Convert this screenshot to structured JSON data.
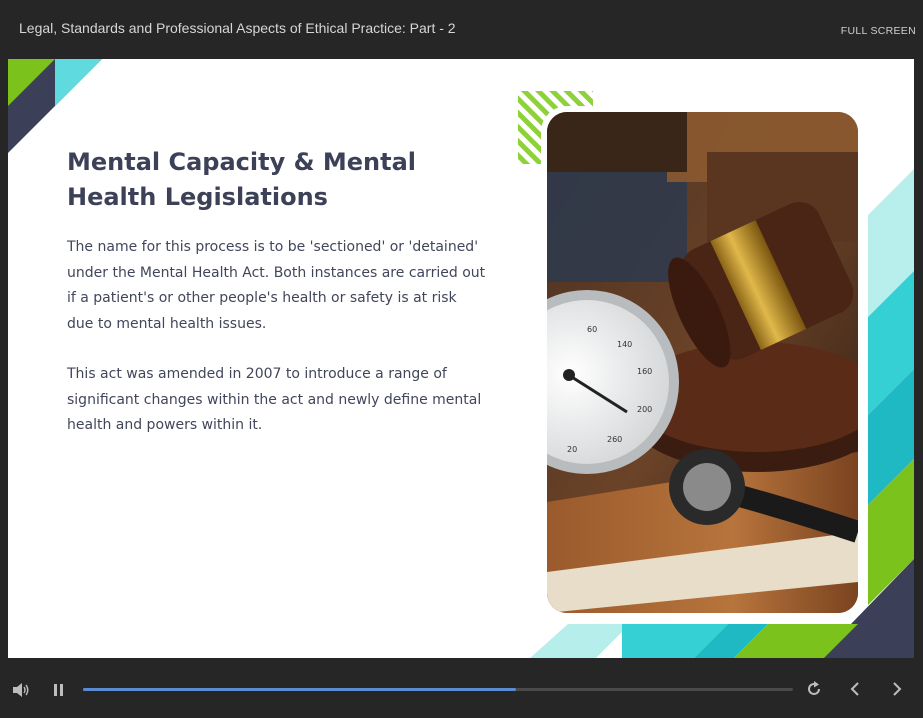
{
  "header": {
    "course_title": "Legal, Standards and Professional Aspects of Ethical Practice: Part - 2",
    "fullscreen_label": "FULL SCREEN"
  },
  "slide": {
    "title": "Mental Capacity & Mental Health Legislations",
    "paragraphs": [
      "The name for this process is to be 'sectioned' or 'detained' under the Mental Health Act. Both instances are carried out if a patient's or other people's health or safety is at risk due to mental health issues.",
      "This act was amended in 2007 to introduce a range of significant changes within the act and newly define mental health and powers within it."
    ],
    "image_subject": "gavel-and-blood-pressure-gauge-on-books"
  },
  "colors": {
    "title": "#3c4158",
    "body_text": "#41465a",
    "teal": "#35d0d3",
    "light_teal": "#b6eeec",
    "green": "#7cc21d",
    "navy": "#3b3f57",
    "progress": "#5b8bd0"
  },
  "controls": {
    "icons": [
      "volume-icon",
      "pause-icon",
      "replay-icon",
      "previous-icon",
      "next-icon"
    ],
    "progress_fraction": 0.61
  }
}
